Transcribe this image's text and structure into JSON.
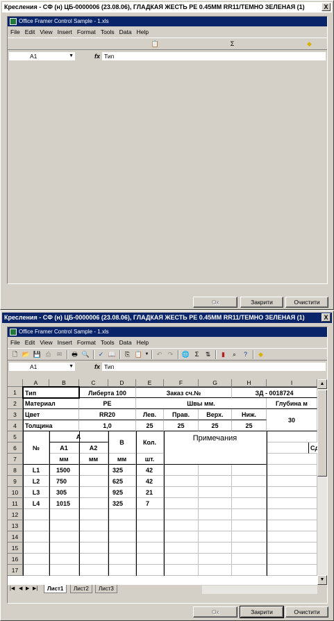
{
  "window_title": "Кресления - СФ (н) ЦБ-0000006 (23.08.06), ГЛАДКАЯ ЖЕСТЬ РЕ 0.45ММ RR11/ТЕМНО ЗЕЛЕНАЯ (1)",
  "doc_title": "Office Framer Control Sample - 1.xls",
  "menu": [
    "File",
    "Edit",
    "View",
    "Insert",
    "Format",
    "Tools",
    "Data",
    "Help"
  ],
  "name_box": "A1",
  "fx_label": "fx",
  "formula_value": "Тип",
  "buttons": {
    "ok": "Ок",
    "close": "Закрити",
    "clear": "Очистити"
  },
  "close_glyph": "X",
  "columns": [
    "A",
    "B",
    "C",
    "D",
    "E",
    "F",
    "G",
    "H",
    "I"
  ],
  "rows": [
    "1",
    "2",
    "3",
    "4",
    "5",
    "6",
    "7",
    "8",
    "9",
    "10",
    "11",
    "12",
    "13",
    "14",
    "15",
    "16",
    "17"
  ],
  "sheet": {
    "r1": {
      "a": "Тип",
      "c": "Либерта 100",
      "e": "Заказ сч.№",
      "h": "ЗД - 0018724"
    },
    "r2": {
      "a": "Материал",
      "c": "PE",
      "f": "Швы мм.",
      "i": "Глубина м"
    },
    "r3": {
      "a": "Цвет",
      "c": "RR20",
      "e": "Лев.",
      "f": "Прав.",
      "g": "Верх.",
      "h": "Ниж.",
      "i": "30"
    },
    "r4": {
      "a": "Толщина",
      "c": "1,0",
      "e": "25",
      "f": "25",
      "g": "25",
      "h": "25"
    },
    "r5": {
      "num": "№",
      "a_hdr": "A",
      "b_hdr": "B",
      "kol": "Кол.",
      "notes": "Примечания",
      "sd": "Сд"
    },
    "r6": {
      "a1": "A1",
      "a2": "A2"
    },
    "r7": {
      "mm1": "мм",
      "mm2": "мм",
      "mm3": "мм",
      "sht": "шт."
    },
    "r8": {
      "no": "L1",
      "a1": "1500",
      "b": "325",
      "k": "42"
    },
    "r9": {
      "no": "L2",
      "a1": "750",
      "b": "625",
      "k": "42"
    },
    "r10": {
      "no": "L3",
      "a1": "305",
      "b": "925",
      "k": "21"
    },
    "r11": {
      "no": "L4",
      "a1": "1015",
      "b": "325",
      "k": "7"
    }
  },
  "tabs": [
    "Лист1",
    "Лист2",
    "Лист3"
  ]
}
